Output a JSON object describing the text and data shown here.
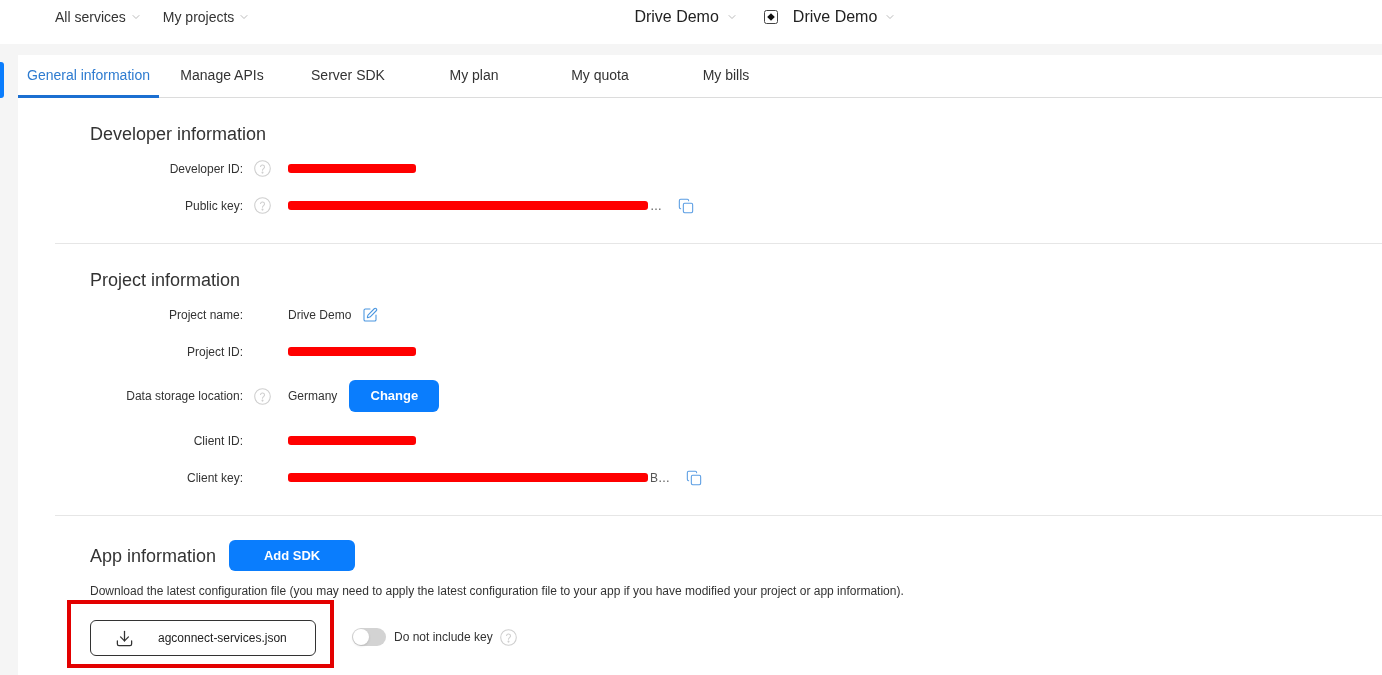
{
  "top_bar": {
    "menus": [
      {
        "label": "All services"
      },
      {
        "label": "My projects"
      }
    ],
    "selectors": [
      {
        "label": "Drive Demo",
        "has_icon": false
      },
      {
        "label": "Drive Demo",
        "has_icon": true
      }
    ]
  },
  "tabs": [
    {
      "label": "General information",
      "selected": true
    },
    {
      "label": "Manage APIs",
      "selected": false
    },
    {
      "label": "Server SDK",
      "selected": false
    },
    {
      "label": "My plan",
      "selected": false
    },
    {
      "label": "My quota",
      "selected": false
    },
    {
      "label": "My bills",
      "selected": false
    }
  ],
  "sections": [
    {
      "kind": "fields",
      "title": "Developer information",
      "fields": [
        {
          "kind": "redacted",
          "label": "Developer ID:",
          "help": true
        },
        {
          "kind": "redacted",
          "label": "Public key:",
          "help": true,
          "tail": "…",
          "action": {
            "kind": "copy"
          }
        }
      ]
    },
    {
      "kind": "fields",
      "title": "Project information",
      "fields": [
        {
          "kind": "text",
          "label": "Project name:",
          "help": false,
          "value": "Drive Demo",
          "action": {
            "kind": "edit"
          }
        },
        {
          "kind": "redacted",
          "label": "Project ID:",
          "help": false
        },
        {
          "kind": "text",
          "label": "Data storage location:",
          "help": true,
          "value": "Germany",
          "action": {
            "kind": "button",
            "label": "Change"
          }
        },
        {
          "kind": "redacted",
          "label": "Client ID:",
          "help": false
        },
        {
          "kind": "redacted",
          "label": "Client key:",
          "help": false,
          "tail": "B…",
          "action": {
            "kind": "copy"
          }
        }
      ]
    },
    {
      "kind": "app",
      "title": "App information",
      "button": "Add SDK",
      "description": "Download the latest configuration file (you may need to apply the latest configuration file to your app if you have modified your project or app information).",
      "download": {
        "label": "agconnect-services.json",
        "highlighted": true
      },
      "toggle": {
        "label": "Do not include key",
        "on": false,
        "help": true
      }
    }
  ]
}
